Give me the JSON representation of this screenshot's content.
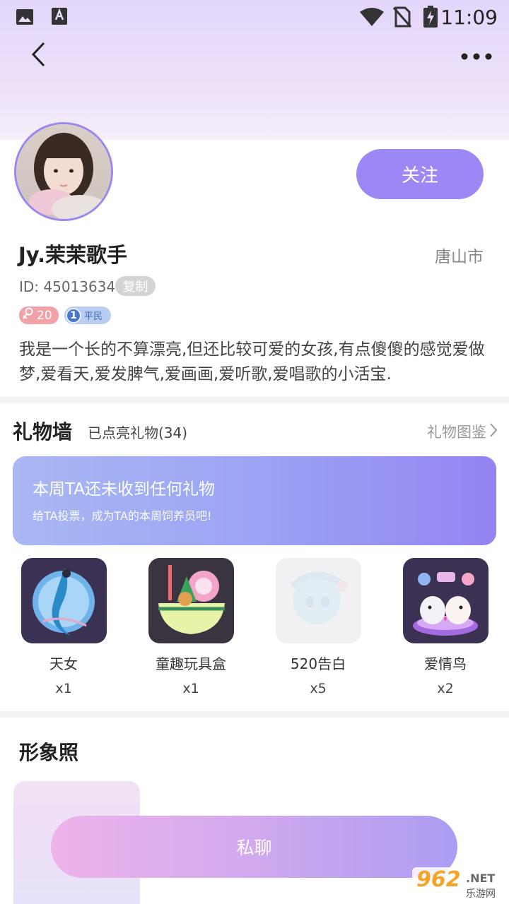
{
  "status_bar": {
    "time": "11:09",
    "icons": [
      "image-icon",
      "keyboard-a-icon",
      "wifi-icon",
      "no-sim-icon",
      "battery-charging-icon"
    ]
  },
  "header": {
    "back_icon": "chevron-left-icon",
    "more_icon": "more-dots-icon"
  },
  "profile": {
    "follow_label": "关注",
    "nickname": "Jy.茉茉歌手",
    "city": "唐山市",
    "id_text": "ID: 45013634",
    "copy_label": "复制",
    "gender_age": "20",
    "level_number": "1",
    "level_name": "平民",
    "bio": "我是一个长的不算漂亮,但还比较可爱的女孩,有点傻傻的感觉爱做梦,爱看天,爱发脾气,爱画画,爱听歌,爱唱歌的小活宝."
  },
  "gift_wall": {
    "title": "礼物墙",
    "lit_count": "已点亮礼物(34)",
    "guide_link": "礼物图鉴",
    "banner_title": "本周TA还未收到任何礼物",
    "banner_subtitle": "给TA投票，成为TA的本周饲养员吧!",
    "gifts": [
      {
        "name": "天女",
        "count": "x1"
      },
      {
        "name": "童趣玩具盒",
        "count": "x1"
      },
      {
        "name": "520告白",
        "count": "x5"
      },
      {
        "name": "爱情鸟",
        "count": "x2"
      }
    ]
  },
  "photos": {
    "title": "形象照"
  },
  "actions": {
    "chat_label": "私聊"
  },
  "watermark": {
    "brand": "962",
    "domain": ".NET",
    "site_name": "乐游网"
  },
  "colors": {
    "accent": "#9d87f5",
    "header_gradient_top": "#e3d6fb",
    "banner_gradient_end": "#9484f2"
  }
}
